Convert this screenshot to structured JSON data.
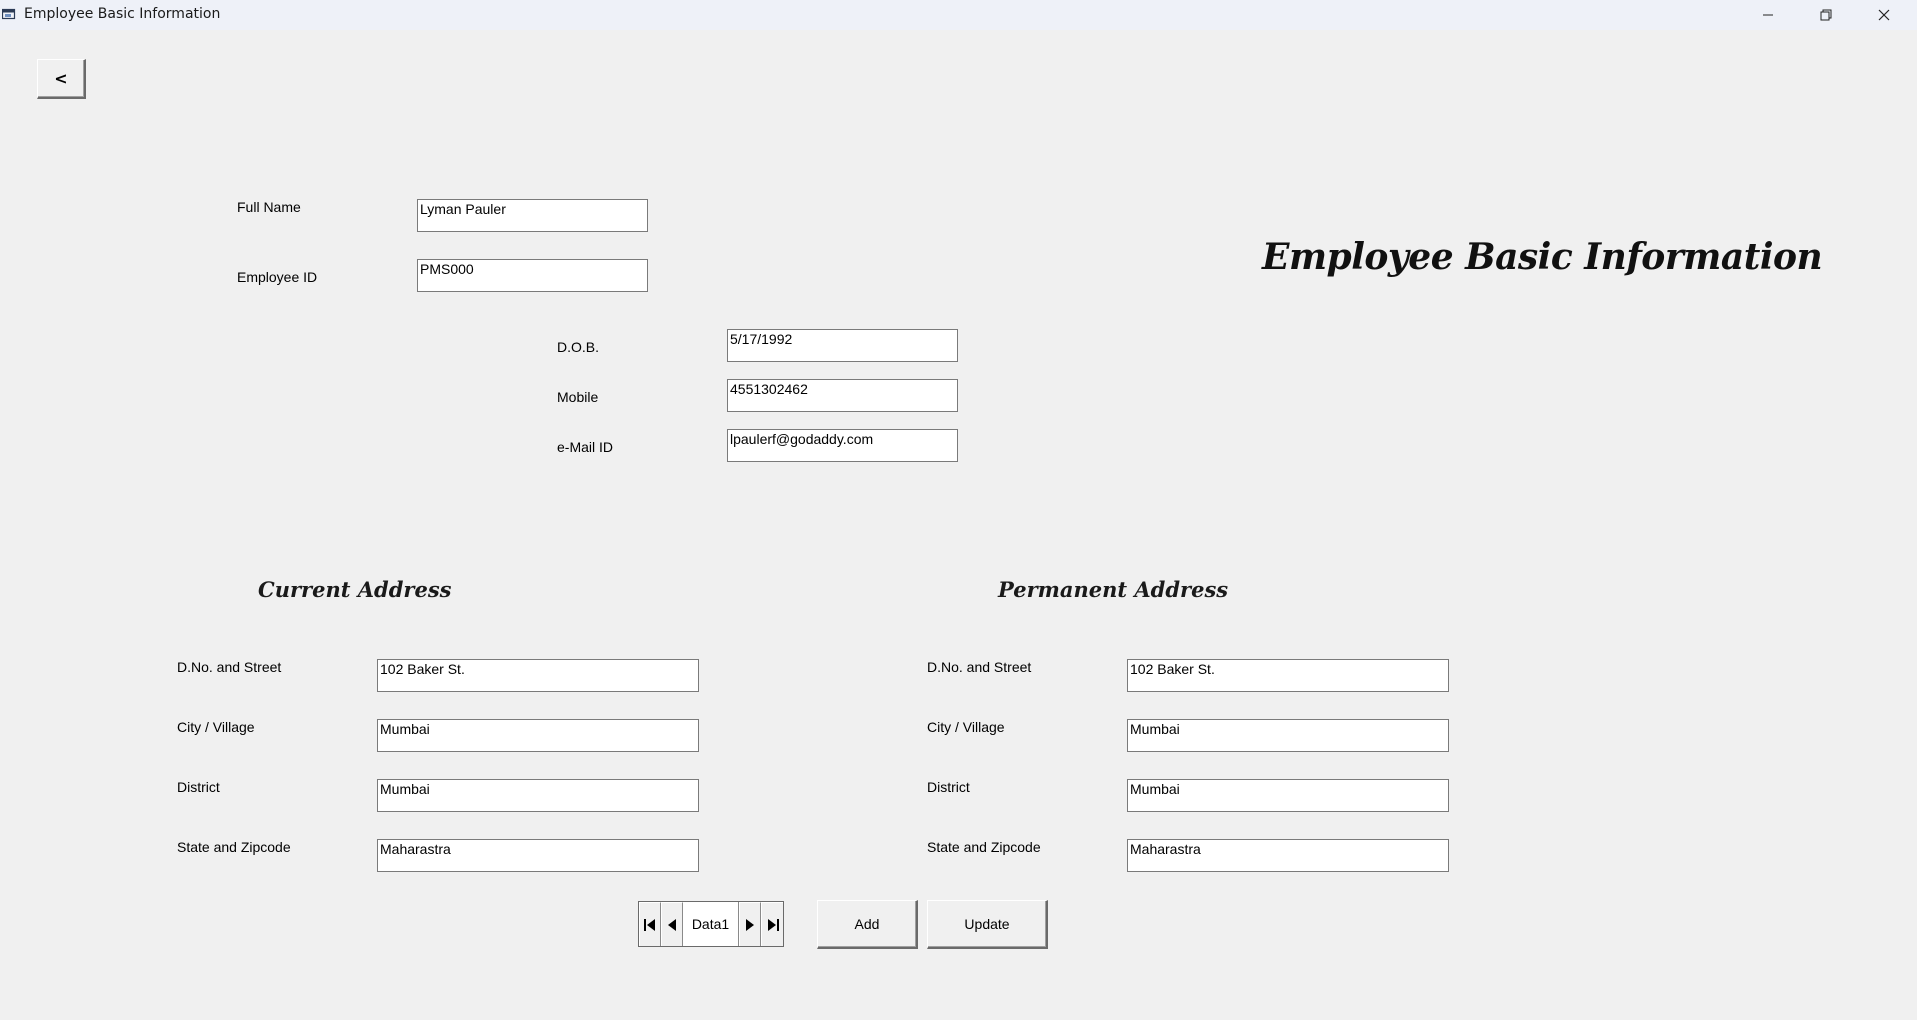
{
  "window": {
    "title": "Employee Basic Information",
    "back_label": "<"
  },
  "heading": "Employee Basic Information",
  "basic": {
    "full_name_label": "Full Name",
    "full_name_value": "Lyman Pauler",
    "employee_id_label": "Employee ID",
    "employee_id_value": "PMS000",
    "dob_label": "D.O.B.",
    "dob_value": "5/17/1992",
    "mobile_label": "Mobile",
    "mobile_value": "4551302462",
    "email_label": "e-Mail ID",
    "email_value": "lpaulerf@godaddy.com"
  },
  "current_address": {
    "title": "Current Address",
    "street_label": "D.No. and Street",
    "street_value": "102 Baker St.",
    "city_label": "City / Village",
    "city_value": "Mumbai",
    "district_label": "District",
    "district_value": "Mumbai",
    "state_label": "State and Zipcode",
    "state_value": "Maharastra"
  },
  "permanent_address": {
    "title": "Permanent Address",
    "street_label": "D.No. and Street",
    "street_value": "102 Baker St.",
    "city_label": "City / Village",
    "city_value": "Mumbai",
    "district_label": "District",
    "district_value": "Mumbai",
    "state_label": "State and Zipcode",
    "state_value": "Maharastra"
  },
  "navigator": {
    "caption": "Data1"
  },
  "buttons": {
    "add_label": "Add",
    "update_label": "Update"
  }
}
